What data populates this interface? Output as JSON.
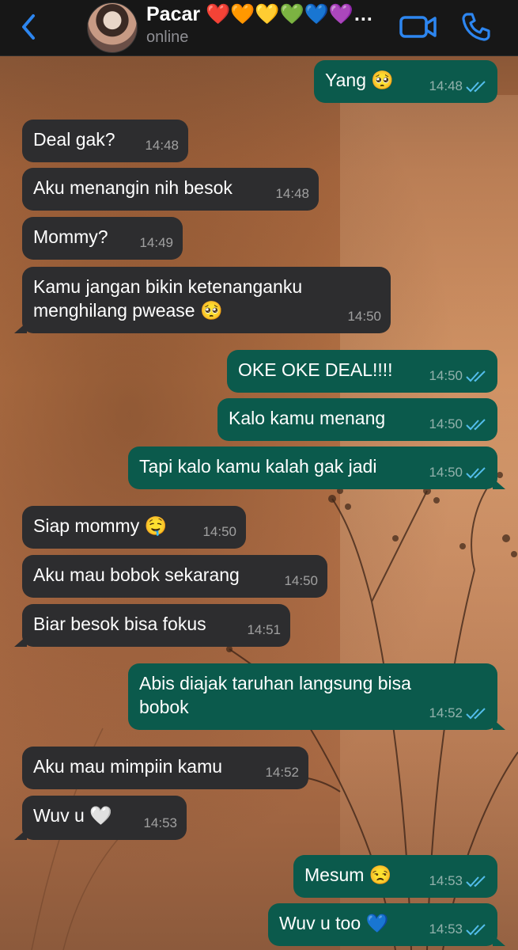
{
  "header": {
    "contact_name": "Pacar ❤️🧡💛💚💙💜…",
    "status": "online"
  },
  "colors": {
    "incoming_bubble": "#2d2d2f",
    "outgoing_bubble": "#0b5a4c",
    "accent": "#2d86f0",
    "read_ticks": "#53bdeb"
  },
  "icons": [
    "chevron-left-icon",
    "video-camera-icon",
    "phone-icon",
    "double-check-icon"
  ],
  "messages": [
    {
      "dir": "out",
      "text": "Yang 🥺",
      "time": "14:48"
    },
    {
      "dir": "in",
      "text": "Deal gak?",
      "time": "14:48"
    },
    {
      "dir": "in",
      "text": "Aku menangin nih besok",
      "time": "14:48"
    },
    {
      "dir": "in",
      "text": "Mommy?",
      "time": "14:49"
    },
    {
      "dir": "in",
      "text": "Kamu jangan bikin ketenanganku\nmenghilang pwease 🥺",
      "time": "14:50"
    },
    {
      "dir": "out",
      "text": "OKE OKE DEAL!!!!",
      "time": "14:50"
    },
    {
      "dir": "out",
      "text": "Kalo kamu menang",
      "time": "14:50"
    },
    {
      "dir": "out",
      "text": "Tapi kalo kamu kalah gak jadi",
      "time": "14:50"
    },
    {
      "dir": "in",
      "text": "Siap mommy 🤤",
      "time": "14:50"
    },
    {
      "dir": "in",
      "text": "Aku mau bobok sekarang",
      "time": "14:50"
    },
    {
      "dir": "in",
      "text": "Biar besok bisa fokus",
      "time": "14:51"
    },
    {
      "dir": "out",
      "text": "Abis diajak taruhan langsung bisa\nbobok",
      "time": "14:52"
    },
    {
      "dir": "in",
      "text": "Aku mau mimpiin kamu",
      "time": "14:52"
    },
    {
      "dir": "in",
      "text": "Wuv u 🤍",
      "time": "14:53"
    },
    {
      "dir": "out",
      "text": "Mesum 😒",
      "time": "14:53"
    },
    {
      "dir": "out",
      "text": "Wuv u too 💙",
      "time": "14:53"
    }
  ]
}
